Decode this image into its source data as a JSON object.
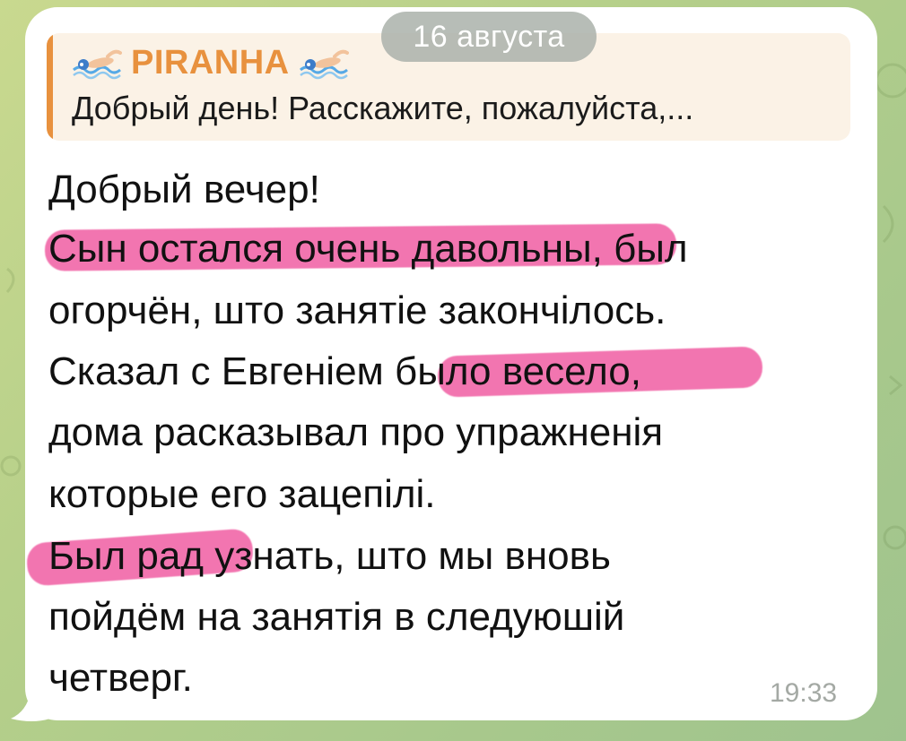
{
  "reply": {
    "sender": "PIRANHA",
    "preview": "Добрый день! Расскажите, пожалуйста,...",
    "accent_color": "#e8913e",
    "icon": "swimmer-icon"
  },
  "date_label": "16 августа",
  "message": {
    "lines": [
      "Добрый вечер!",
      "Сын остался очень давольны, был",
      "огорчён, што занятіе закончілось.",
      "Сказал с Евгеніем было весело,",
      "дома расказывал про упражненія",
      "которые его зацепілі.",
      "Был рад узнать, што мы вновь",
      "пойдём на занятія в следуюшій",
      "четверг."
    ],
    "highlighted_phrases": [
      "Сын остался очень давольны",
      "было весело,",
      "Был рад"
    ],
    "highlight_color": "#ef4f9a",
    "time": "19:33"
  }
}
